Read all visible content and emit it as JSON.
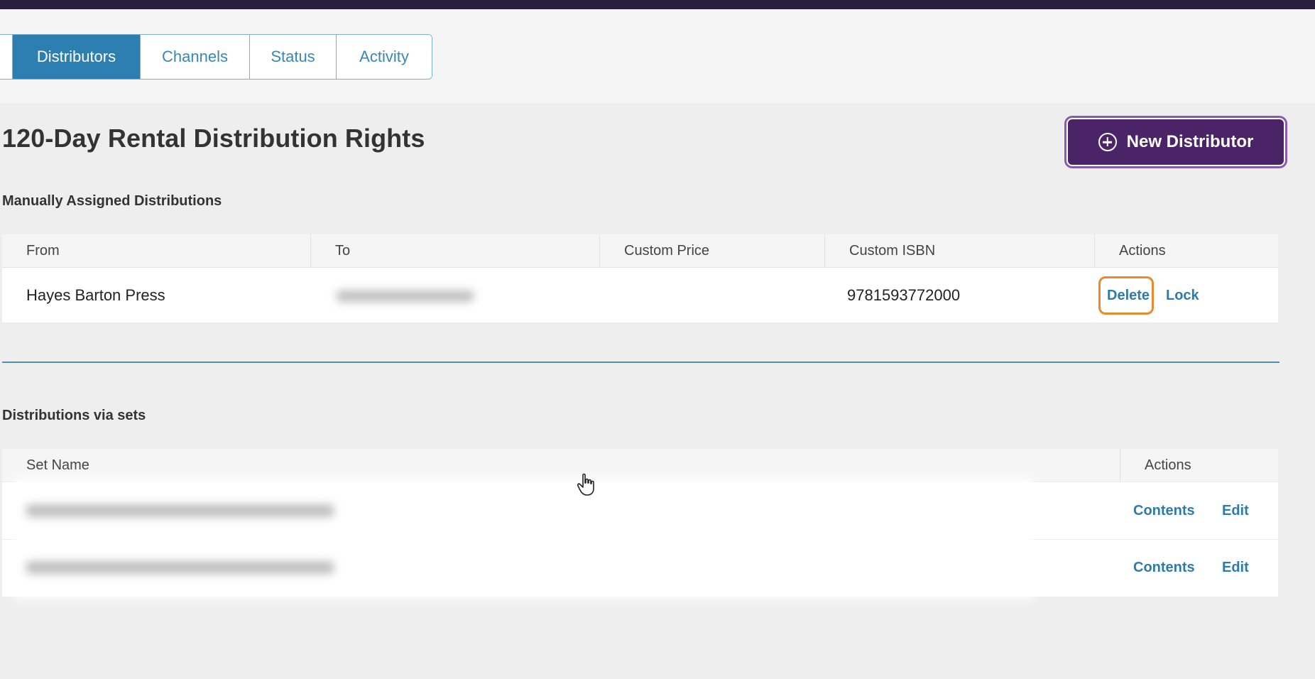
{
  "tabs": [
    {
      "label": "Distributors",
      "active": true
    },
    {
      "label": "Channels",
      "active": false
    },
    {
      "label": "Status",
      "active": false
    },
    {
      "label": "Activity",
      "active": false
    }
  ],
  "page": {
    "title": "120-Day Rental Distribution Rights",
    "new_button_label": "New Distributor",
    "new_button_icon": "plus-circle-icon"
  },
  "manual": {
    "heading": "Manually Assigned Distributions",
    "columns": [
      "From",
      "To",
      "Custom Price",
      "Custom ISBN",
      "Actions"
    ],
    "rows": [
      {
        "from": "Hayes Barton Press",
        "to": "",
        "custom_price": "",
        "custom_isbn": "9781593772000",
        "actions": [
          "Delete",
          "Lock"
        ]
      }
    ]
  },
  "sets": {
    "heading": "Distributions via sets",
    "columns": [
      "Set Name",
      "Actions"
    ],
    "rows": [
      {
        "name": "",
        "actions": [
          "Contents",
          "Edit"
        ]
      },
      {
        "name": "",
        "actions": [
          "Contents",
          "Edit"
        ]
      }
    ]
  },
  "colors": {
    "accent": "#2d7fb2",
    "brand_purple": "#4a2466",
    "topbar": "#2c1f3c",
    "focus_ring": "#ea8a30",
    "link": "#2e7bab"
  }
}
